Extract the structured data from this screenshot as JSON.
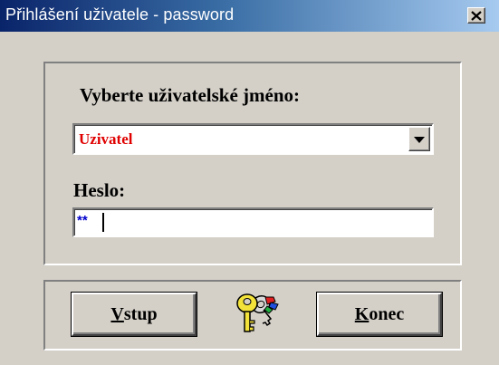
{
  "window": {
    "title": "Přihlášení uživatele - password"
  },
  "form": {
    "user_label": "Vyberte uživatelské jméno:",
    "user_value": "Uzivatel",
    "password_label": "Heslo:",
    "password_value": "**"
  },
  "buttons": {
    "enter_mnemonic": "V",
    "enter_rest": "stup",
    "exit_mnemonic": "K",
    "exit_rest": "onec"
  },
  "colors": {
    "title_gradient_start": "#0a246a",
    "title_gradient_end": "#a6caf0",
    "dialog_face": "#d4d0c8",
    "user_value_color": "#e00000",
    "password_value_color": "#0000cc"
  },
  "icons": {
    "close": "close-icon",
    "dropdown": "dropdown-arrow-icon",
    "keys": "keys-icon"
  }
}
